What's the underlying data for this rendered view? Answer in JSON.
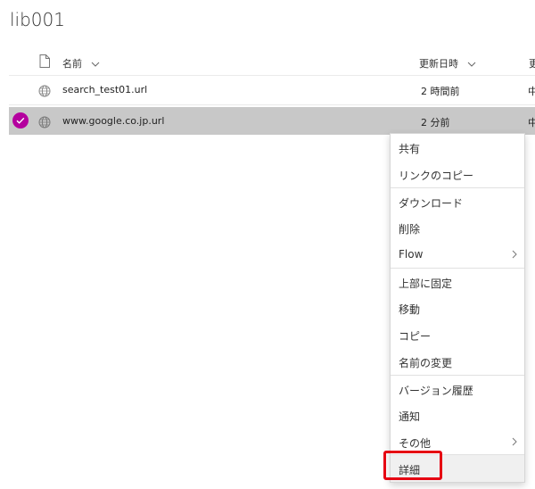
{
  "library": {
    "title": "lib001"
  },
  "header": {
    "name_label": "名前",
    "modified_label": "更新日時",
    "extra_label": "更"
  },
  "files": [
    {
      "name": "search_test01.url",
      "modified": "2 時間前",
      "extra": "中",
      "selected": false
    },
    {
      "name": "www.google.co.jp.url",
      "modified": "2 分前",
      "extra": "中",
      "selected": true
    }
  ],
  "context_menu": {
    "items": [
      {
        "label": "共有",
        "submenu": false
      },
      {
        "label": "リンクのコピー",
        "submenu": false
      },
      {
        "label": "ダウンロード",
        "submenu": false
      },
      {
        "label": "削除",
        "submenu": false
      },
      {
        "label": "Flow",
        "submenu": true
      },
      {
        "label": "上部に固定",
        "submenu": false
      },
      {
        "label": "移動",
        "submenu": false
      },
      {
        "label": "コピー",
        "submenu": false
      },
      {
        "label": "名前の変更",
        "submenu": false
      },
      {
        "label": "バージョン履歴",
        "submenu": false
      },
      {
        "label": "通知",
        "submenu": false
      },
      {
        "label": "その他",
        "submenu": true
      },
      {
        "label": "詳細",
        "submenu": false
      }
    ]
  },
  "colors": {
    "selection_accent": "#b4009e",
    "selected_row": "#c8c8c8",
    "highlight_box": "#e60012"
  },
  "icons": [
    "file-icon",
    "globe-icon",
    "check-icon",
    "chevron-down-icon",
    "chevron-right-icon"
  ]
}
